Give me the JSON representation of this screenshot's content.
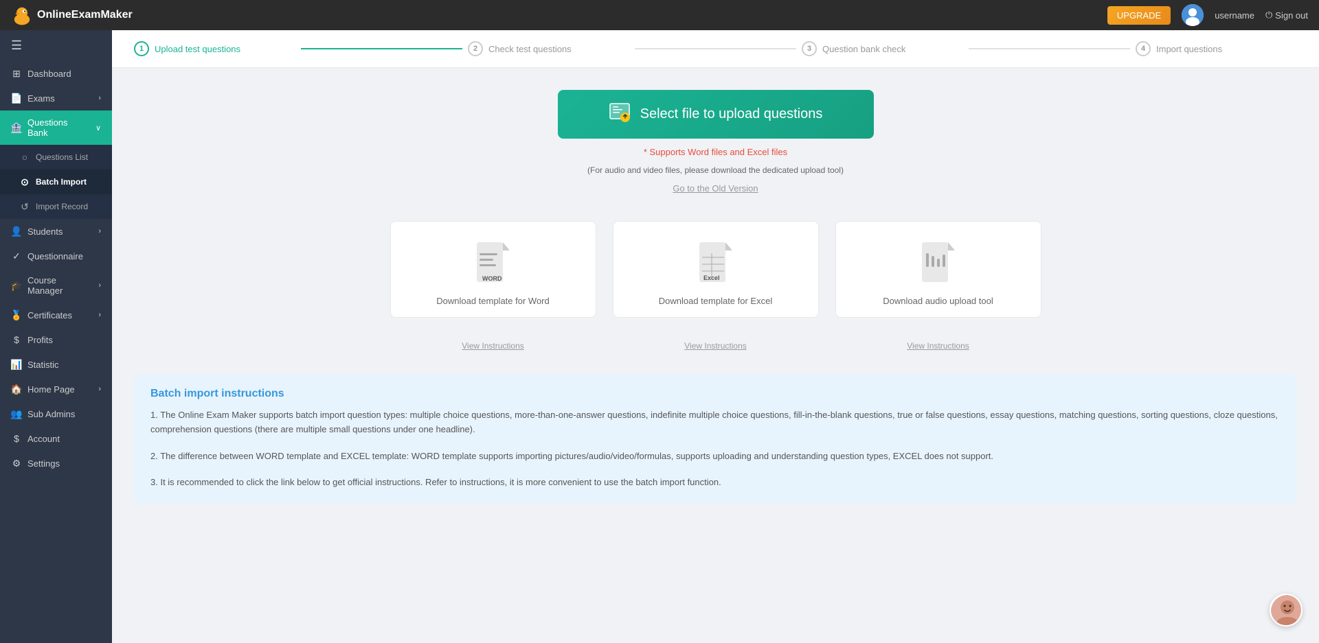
{
  "topbar": {
    "logo_text": "OnlineExamMaker",
    "upgrade_label": "UPGRADE",
    "username": "username",
    "signout_label": "Sign out"
  },
  "sidebar": {
    "toggle_icon": "☰",
    "items": [
      {
        "id": "dashboard",
        "label": "Dashboard",
        "icon": "⊞",
        "active": false
      },
      {
        "id": "exams",
        "label": "Exams",
        "icon": "📄",
        "active": false,
        "hasArrow": true
      },
      {
        "id": "questions-bank",
        "label": "Questions Bank",
        "icon": "🏦",
        "active": true,
        "hasArrow": true
      },
      {
        "id": "questions-list",
        "label": "Questions List",
        "icon": "○",
        "active": false,
        "sub": true
      },
      {
        "id": "batch-import",
        "label": "Batch Import",
        "icon": "⊙",
        "active": true,
        "sub": true
      },
      {
        "id": "import-record",
        "label": "Import Record",
        "icon": "↺",
        "active": false,
        "sub": true
      },
      {
        "id": "students",
        "label": "Students",
        "icon": "👤",
        "active": false,
        "hasArrow": true
      },
      {
        "id": "questionnaire",
        "label": "Questionnaire",
        "icon": "✓",
        "active": false
      },
      {
        "id": "course-manager",
        "label": "Course Manager",
        "icon": "🎓",
        "active": false,
        "hasArrow": true
      },
      {
        "id": "certificates",
        "label": "Certificates",
        "icon": "🏅",
        "active": false,
        "hasArrow": true
      },
      {
        "id": "profits",
        "label": "Profits",
        "icon": "$",
        "active": false
      },
      {
        "id": "statistic",
        "label": "Statistic",
        "icon": "📊",
        "active": false
      },
      {
        "id": "home-page",
        "label": "Home Page",
        "icon": "🏠",
        "active": false,
        "hasArrow": true
      },
      {
        "id": "sub-admins",
        "label": "Sub Admins",
        "icon": "👥",
        "active": false
      },
      {
        "id": "account",
        "label": "Account",
        "icon": "$",
        "active": false
      },
      {
        "id": "settings",
        "label": "Settings",
        "icon": "⚙",
        "active": false
      }
    ]
  },
  "wizard": {
    "steps": [
      {
        "id": 1,
        "label": "Upload test questions",
        "active": true
      },
      {
        "id": 2,
        "label": "Check test questions",
        "active": false
      },
      {
        "id": 3,
        "label": "Question bank check",
        "active": false
      },
      {
        "id": 4,
        "label": "Import questions",
        "active": false
      }
    ]
  },
  "upload": {
    "button_label": "Select file to upload questions",
    "support_text": "* Supports Word files and Excel files",
    "support_sub": "(For audio and video files, please download the dedicated upload tool)",
    "old_version_link": "Go to the Old Version"
  },
  "templates": [
    {
      "id": "word",
      "type": "word",
      "label": "Download template for Word",
      "view_instructions": "View Instructions"
    },
    {
      "id": "excel",
      "type": "excel",
      "label": "Download template for Excel",
      "view_instructions": "View Instructions"
    },
    {
      "id": "audio",
      "type": "audio",
      "label": "Download audio upload tool",
      "view_instructions": "View Instructions"
    }
  ],
  "instructions": {
    "title": "Batch import instructions",
    "text1": "1. The Online Exam Maker supports batch import question types: multiple choice questions, more-than-one-answer questions, indefinite multiple choice questions, fill-in-the-blank questions, true or false questions, essay questions, matching questions, sorting questions, cloze questions, comprehension questions (there are multiple small questions under one headline).",
    "text2": "2. The difference between WORD template and EXCEL template: WORD template supports importing pictures/audio/video/formulas, supports uploading and understanding question types, EXCEL does not support.",
    "text3": "3. It is recommended to click the link below to get official instructions. Refer to instructions, it is more convenient to use the batch import function."
  }
}
